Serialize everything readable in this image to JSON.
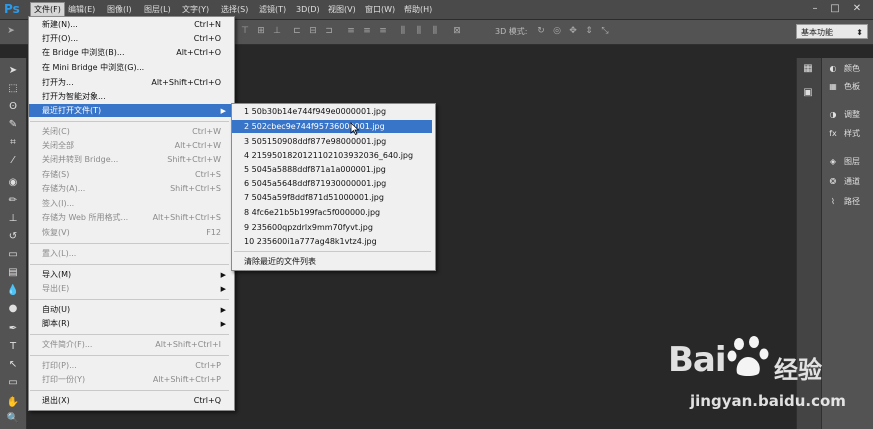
{
  "app": {
    "logo": "Ps"
  },
  "menubar": {
    "items": [
      {
        "label": "文件(F)"
      },
      {
        "label": "编辑(E)"
      },
      {
        "label": "图像(I)"
      },
      {
        "label": "图层(L)"
      },
      {
        "label": "文字(Y)"
      },
      {
        "label": "选择(S)"
      },
      {
        "label": "滤镜(T)"
      },
      {
        "label": "3D(D)"
      },
      {
        "label": "视图(V)"
      },
      {
        "label": "窗口(W)"
      },
      {
        "label": "帮助(H)"
      }
    ],
    "window_controls": [
      "–",
      "□",
      "✕"
    ]
  },
  "options_bar": {
    "mode3d_label": "3D 模式:",
    "workspace": "基本功能"
  },
  "panels": [
    {
      "label": "颜色"
    },
    {
      "label": "色板"
    },
    {
      "label": "调整"
    },
    {
      "label": "样式"
    },
    {
      "label": "图层"
    },
    {
      "label": "通道"
    },
    {
      "label": "路径"
    }
  ],
  "file_menu": {
    "items": [
      {
        "label": "新建(N)...",
        "shortcut": "Ctrl+N",
        "enabled": true
      },
      {
        "label": "打开(O)...",
        "shortcut": "Ctrl+O",
        "enabled": true
      },
      {
        "label": "在 Bridge 中浏览(B)...",
        "shortcut": "Alt+Ctrl+O",
        "enabled": true
      },
      {
        "label": "在 Mini Bridge 中浏览(G)...",
        "shortcut": "",
        "enabled": true
      },
      {
        "label": "打开为...",
        "shortcut": "Alt+Shift+Ctrl+O",
        "enabled": true
      },
      {
        "label": "打开为智能对象...",
        "shortcut": "",
        "enabled": true
      },
      {
        "label": "最近打开文件(T)",
        "shortcut": "",
        "enabled": true,
        "submenu": true,
        "highlighted": true
      },
      {
        "label": "关闭(C)",
        "shortcut": "Ctrl+W",
        "enabled": false
      },
      {
        "label": "关闭全部",
        "shortcut": "Alt+Ctrl+W",
        "enabled": false
      },
      {
        "label": "关闭并转到 Bridge...",
        "shortcut": "Shift+Ctrl+W",
        "enabled": false
      },
      {
        "label": "存储(S)",
        "shortcut": "Ctrl+S",
        "enabled": false
      },
      {
        "label": "存储为(A)...",
        "shortcut": "Shift+Ctrl+S",
        "enabled": false
      },
      {
        "label": "签入(I)...",
        "shortcut": "",
        "enabled": false
      },
      {
        "label": "存储为 Web 所用格式...",
        "shortcut": "Alt+Shift+Ctrl+S",
        "enabled": false
      },
      {
        "label": "恢复(V)",
        "shortcut": "F12",
        "enabled": false
      },
      {
        "label": "置入(L)...",
        "shortcut": "",
        "enabled": false
      },
      {
        "label": "导入(M)",
        "shortcut": "",
        "enabled": true,
        "submenu": true
      },
      {
        "label": "导出(E)",
        "shortcut": "",
        "enabled": false,
        "submenu": true
      },
      {
        "label": "自动(U)",
        "shortcut": "",
        "enabled": true,
        "submenu": true
      },
      {
        "label": "脚本(R)",
        "shortcut": "",
        "enabled": true,
        "submenu": true
      },
      {
        "label": "文件简介(F)...",
        "shortcut": "Alt+Shift+Ctrl+I",
        "enabled": false
      },
      {
        "label": "打印(P)...",
        "shortcut": "Ctrl+P",
        "enabled": false
      },
      {
        "label": "打印一份(Y)",
        "shortcut": "Alt+Shift+Ctrl+P",
        "enabled": false
      },
      {
        "label": "退出(X)",
        "shortcut": "Ctrl+Q",
        "enabled": true
      }
    ]
  },
  "recent_files": {
    "items": [
      {
        "label": "1  50b30b14e744f949e0000001.jpg"
      },
      {
        "label": "2  502cbec9e744f95736000001.jpg",
        "highlighted": true
      },
      {
        "label": "3  505150908ddf877e98000001.jpg"
      },
      {
        "label": "4  215950182012110210393​2036_640.jpg"
      },
      {
        "label": "5  5045a5888ddf871a1a000001.jpg"
      },
      {
        "label": "6  5045a5648ddf871930000001.jpg"
      },
      {
        "label": "7  5045a59f8ddf871d51000001.jpg"
      },
      {
        "label": "8  4fc6e21b5b199fac5f000000.jpg"
      },
      {
        "label": "9  235600qpzdrlx9mm70fyvt.jpg"
      },
      {
        "label": "10  235600i1a777ag48k1vtz4.jpg"
      }
    ],
    "clear_label": "清除最近的文件列表"
  },
  "watermark": {
    "brand": "Bai",
    "brand2": "经验",
    "url": "jingyan.baidu.com"
  },
  "colors": {
    "highlight": "#3874c8",
    "menu_bg": "#f0f0f0",
    "canvas": "#282828",
    "panel": "#535353"
  }
}
